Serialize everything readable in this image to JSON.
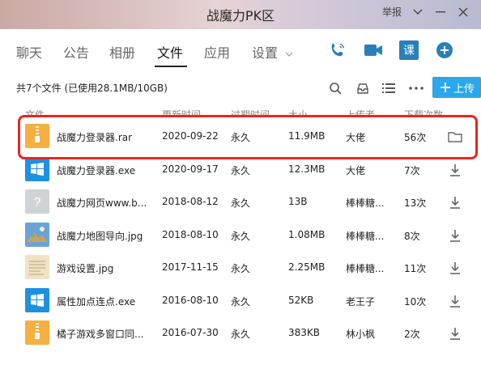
{
  "window": {
    "title": "战魔力PK区",
    "report_label": "举报",
    "icons": [
      "chevron-down-icon",
      "minimize-icon",
      "close-icon"
    ]
  },
  "tabs": [
    {
      "label": "聊天",
      "active": false
    },
    {
      "label": "公告",
      "active": false
    },
    {
      "label": "相册",
      "active": false
    },
    {
      "label": "文件",
      "active": true
    },
    {
      "label": "应用",
      "active": false
    },
    {
      "label": "设置",
      "active": false
    }
  ],
  "tab_icons": [
    "phone-icon",
    "video-icon",
    "lesson-icon",
    "add-icon"
  ],
  "lesson_icon_char": "课",
  "toolbar": {
    "summary": "共7个文件 (已使用28.1MB/10GB)",
    "upload_label": "上传",
    "accent": "#2ba7ec"
  },
  "table": {
    "headers": [
      "文件",
      "更新时间",
      "过期时间",
      "大小",
      "上传者",
      "下载次数"
    ],
    "rows": [
      {
        "icon": "archive",
        "name": "战魔力登录器.rar",
        "updated": "2020-09-22",
        "expires": "永久",
        "size": "11.9MB",
        "uploader": "大佬",
        "downloads": "56次",
        "action": "folder-icon"
      },
      {
        "icon": "windows",
        "name": "战魔力登录器.exe",
        "updated": "2020-09-17",
        "expires": "永久",
        "size": "12.3MB",
        "uploader": "大佬",
        "downloads": "7次",
        "action": "download-icon"
      },
      {
        "icon": "unknown",
        "name": "战魔力网页www.b...",
        "updated": "2018-08-12",
        "expires": "永久",
        "size": "13B",
        "uploader": "棒棒糖...",
        "downloads": "13次",
        "action": "download-icon"
      },
      {
        "icon": "map-image",
        "name": "战魔力地图导向.jpg",
        "updated": "2018-08-10",
        "expires": "永久",
        "size": "1.08MB",
        "uploader": "棒棒糖...",
        "downloads": "8次",
        "action": "download-icon"
      },
      {
        "icon": "doc-image",
        "name": "游戏设置.jpg",
        "updated": "2017-11-15",
        "expires": "永久",
        "size": "2.25MB",
        "uploader": "棒棒糖...",
        "downloads": "11次",
        "action": "download-icon"
      },
      {
        "icon": "windows",
        "name": "属性加点连点.exe",
        "updated": "2016-08-10",
        "expires": "永久",
        "size": "52KB",
        "uploader": "老王子",
        "downloads": "10次",
        "action": "download-icon"
      },
      {
        "icon": "archive",
        "name": "橘子游戏多窗口同...",
        "updated": "2016-07-30",
        "expires": "永久",
        "size": "383KB",
        "uploader": "林小枫",
        "downloads": "2次",
        "action": "download-icon"
      }
    ]
  },
  "highlight_color": "#e8271f"
}
